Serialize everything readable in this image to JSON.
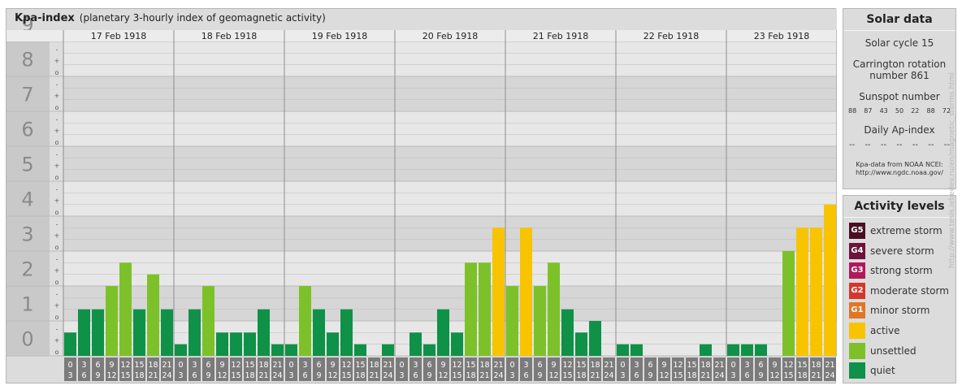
{
  "title": "Kpa-index",
  "subtitle": "(planetary 3-hourly index of geomagnetic activity)",
  "chart_data": {
    "type": "bar",
    "title": "Kpa-index",
    "subtitle": "(planetary 3-hourly index of geomagnetic activity)",
    "ylim": [
      0,
      9
    ],
    "y_ticks": [
      "0",
      "1",
      "2",
      "3",
      "4",
      "5",
      "6",
      "7",
      "8",
      "9"
    ],
    "y_subticks": [
      "o",
      "+",
      "-"
    ],
    "days": [
      "17 Feb 1918",
      "18 Feb 1918",
      "19 Feb 1918",
      "20 Feb 1918",
      "21 Feb 1918",
      "22 Feb 1918",
      "23 Feb 1918"
    ],
    "interval_starts": [
      "0",
      "3",
      "6",
      "9",
      "12",
      "15",
      "18",
      "21"
    ],
    "interval_ends": [
      "3",
      "6",
      "9",
      "12",
      "15",
      "18",
      "21",
      "24"
    ],
    "values": [
      [
        0.667,
        1.333,
        1.333,
        2.0,
        2.667,
        1.333,
        2.333,
        1.333
      ],
      [
        0.333,
        1.333,
        2.0,
        0.667,
        0.667,
        0.667,
        1.333,
        0.333
      ],
      [
        0.333,
        2.0,
        1.333,
        0.667,
        1.333,
        0.333,
        0.0,
        0.333
      ],
      [
        0.0,
        0.667,
        0.333,
        1.333,
        0.667,
        2.667,
        2.667,
        3.667
      ],
      [
        2.0,
        3.667,
        2.0,
        2.667,
        1.333,
        0.667,
        1.0,
        0.0
      ],
      [
        0.333,
        0.333,
        0.0,
        0.0,
        0.0,
        0.0,
        0.333,
        0.0
      ],
      [
        0.333,
        0.333,
        0.333,
        0.0,
        3.0,
        3.667,
        3.667,
        4.333
      ]
    ],
    "colors": {
      "quiet": "#0f9148",
      "unsettled": "#7dc12a",
      "active": "#f8c400"
    },
    "grid": true
  },
  "solar": {
    "title": "Solar data",
    "cycle": "Solar cycle 15",
    "carrington_line1": "Carrington rotation",
    "carrington_line2": "number 861",
    "sunspot_label": "Sunspot number",
    "sunspot_values": [
      "88",
      "87",
      "43",
      "50",
      "22",
      "88",
      "72"
    ],
    "ap_label": "Daily Ap-index",
    "ap_values": [
      "--",
      "--",
      "--",
      "--",
      "--",
      "--",
      "--"
    ],
    "source_line1": "Kpa-data from NOAA NCEI:",
    "source_line2": "http://www.ngdc.noaa.gov/"
  },
  "activity": {
    "title": "Activity levels",
    "levels": [
      {
        "badge": "G5",
        "label": "extreme storm",
        "color": "#4a0f23"
      },
      {
        "badge": "G4",
        "label": "severe storm",
        "color": "#6d1238"
      },
      {
        "badge": "G3",
        "label": "strong storm",
        "color": "#b0195c"
      },
      {
        "badge": "G2",
        "label": "moderate storm",
        "color": "#d3382a"
      },
      {
        "badge": "G1",
        "label": "minor storm",
        "color": "#e07626"
      },
      {
        "badge": "",
        "label": "active",
        "color": "#f8c400"
      },
      {
        "badge": "",
        "label": "unsettled",
        "color": "#7dc12a"
      },
      {
        "badge": "",
        "label": "quiet",
        "color": "#0f9148"
      }
    ]
  },
  "watermark": "http://www.tesis.lebedev.ru/en/magnetic_storms.html"
}
